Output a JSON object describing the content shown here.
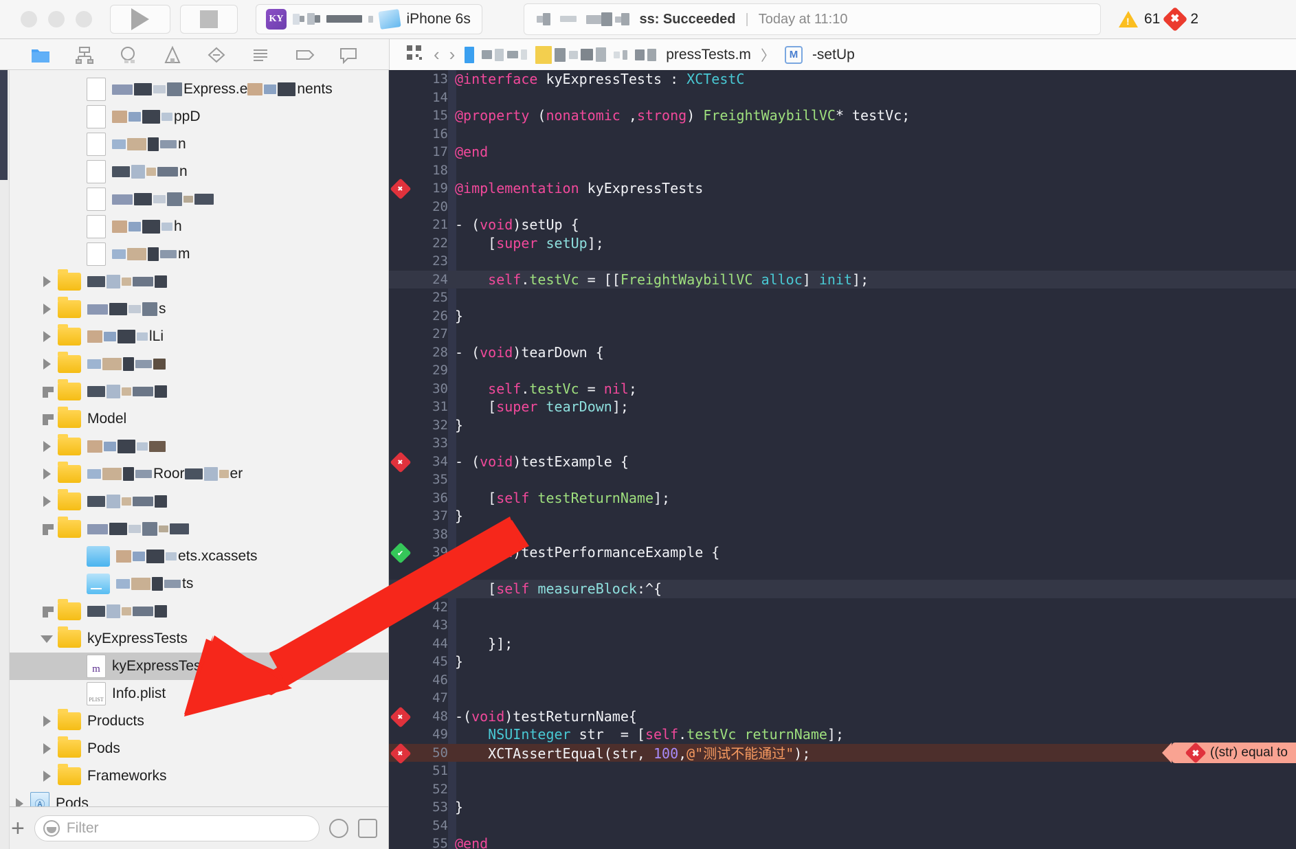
{
  "toolbar": {
    "scheme_name": "iPhone 6s",
    "app_icon_text": "KY",
    "status_text": "ss: Succeeded",
    "status_divider": "|",
    "status_time": "Today at 11:10",
    "warning_count": "61",
    "error_count": "2",
    "error_badge_glyph": "✖",
    "warning_glyph": "!",
    "play_label": "run-button",
    "stop_label": "stop-button"
  },
  "navigator_toolbar": {
    "icons": [
      {
        "name": "project-navigator-icon",
        "active": true
      },
      {
        "name": "source-control-navigator-icon",
        "active": false
      },
      {
        "name": "symbol-navigator-icon",
        "active": false
      },
      {
        "name": "find-navigator-icon",
        "active": false
      },
      {
        "name": "issue-navigator-icon",
        "active": false
      },
      {
        "name": "test-navigator-icon",
        "active": false
      },
      {
        "name": "debug-navigator-icon",
        "active": false
      },
      {
        "name": "breakpoint-navigator-icon",
        "active": false
      },
      {
        "name": "report-navigator-icon",
        "active": false
      }
    ]
  },
  "jumpbar": {
    "related_items_icon": "grid-icon",
    "back_arrow": "‹",
    "forward_arrow": "›",
    "crumb_blurred": "",
    "crumb_file": "pressTests.m",
    "separator": "〉",
    "method_badge": "M",
    "crumb_method": "-setUp"
  },
  "navigator": {
    "rows": [
      {
        "label": "Express.e",
        "suffix": "nents",
        "kind": "file-blurred",
        "indent": 2,
        "twisty": "none",
        "blurred": true
      },
      {
        "label": "ppD",
        "kind": "file-blurred",
        "indent": 2,
        "twisty": "none",
        "blurred": true
      },
      {
        "label": "n",
        "kind": "file-blurred",
        "indent": 2,
        "twisty": "none",
        "blurred": true
      },
      {
        "label": "n",
        "kind": "file-blurred",
        "indent": 2,
        "twisty": "none",
        "blurred": true
      },
      {
        "label": "",
        "kind": "file-blurred",
        "indent": 2,
        "twisty": "none",
        "blurred": true
      },
      {
        "label": "h",
        "kind": "file-blurred",
        "indent": 2,
        "twisty": "none",
        "blurred": true
      },
      {
        "label": "m",
        "kind": "file-blurred",
        "indent": 2,
        "twisty": "none",
        "blurred": true
      },
      {
        "label": "",
        "kind": "folder",
        "indent": 1,
        "twisty": "closed",
        "blurred": true
      },
      {
        "label": "s",
        "kind": "folder",
        "indent": 1,
        "twisty": "closed",
        "blurred": true
      },
      {
        "label": "lLi",
        "kind": "folder",
        "indent": 1,
        "twisty": "closed",
        "blurred": true
      },
      {
        "label": "",
        "kind": "folder",
        "indent": 1,
        "twisty": "closed",
        "blurred": true
      },
      {
        "label": "",
        "kind": "folder",
        "indent": 1,
        "twisty": "half",
        "blurred": true
      },
      {
        "label": "Model",
        "kind": "folder",
        "indent": 1,
        "twisty": "half",
        "blurred": false
      },
      {
        "label": "",
        "kind": "folder",
        "indent": 1,
        "twisty": "closed",
        "blurred": true
      },
      {
        "label": "Roor",
        "suffix": "er",
        "kind": "folder",
        "indent": 1,
        "twisty": "closed",
        "blurred": true
      },
      {
        "label": "",
        "kind": "folder",
        "indent": 1,
        "twisty": "closed",
        "blurred": true
      },
      {
        "label": "",
        "kind": "folder",
        "indent": 1,
        "twisty": "half",
        "blurred": true
      },
      {
        "label": "ets.xcassets",
        "kind": "xcassets",
        "indent": 2,
        "twisty": "none",
        "blurred": true
      },
      {
        "label": "ts",
        "kind": "storyboard",
        "indent": 2,
        "twisty": "none",
        "blurred": true
      },
      {
        "label": "",
        "kind": "folder",
        "indent": 1,
        "twisty": "half",
        "blurred": true
      },
      {
        "label": "kyExpressTests",
        "kind": "folder",
        "indent": 1,
        "twisty": "open",
        "blurred": false
      },
      {
        "label": "kyExpressTests.m",
        "kind": "m-file",
        "indent": 2,
        "twisty": "none",
        "blurred": false,
        "selected": true
      },
      {
        "label": "Info.plist",
        "kind": "plist",
        "indent": 2,
        "twisty": "none",
        "blurred": false
      },
      {
        "label": "Products",
        "kind": "folder",
        "indent": 1,
        "twisty": "closed",
        "blurred": false
      },
      {
        "label": "Pods",
        "kind": "folder",
        "indent": 1,
        "twisty": "closed",
        "blurred": false
      },
      {
        "label": "Frameworks",
        "kind": "folder",
        "indent": 1,
        "twisty": "closed",
        "blurred": false
      },
      {
        "label": "Pods",
        "kind": "project",
        "indent": 0,
        "twisty": "closed",
        "blurred": false
      }
    ],
    "footer": {
      "add_label": "+",
      "filter_placeholder": "Filter",
      "recent_icon": "clock-icon",
      "sourcecontrol_icon": "modified-files-icon"
    }
  },
  "editor": {
    "error_balloon": "((str) equal to",
    "error_balloon_glyph": "✖",
    "lines": [
      {
        "n": "13",
        "mark": "",
        "state": "",
        "tokens": [
          {
            "t": "@interface",
            "c": "k"
          },
          {
            "t": " ",
            "c": "w"
          },
          {
            "t": "kyExpressTests",
            "c": "w"
          },
          {
            "t": " : ",
            "c": "w"
          },
          {
            "t": "XCTestC",
            "c": "type"
          }
        ]
      },
      {
        "n": "14",
        "mark": "",
        "state": "",
        "tokens": []
      },
      {
        "n": "15",
        "mark": "",
        "state": "",
        "tokens": [
          {
            "t": "@property",
            "c": "k"
          },
          {
            "t": " (",
            "c": "w"
          },
          {
            "t": "nonatomic",
            "c": "k"
          },
          {
            "t": " ,",
            "c": "w"
          },
          {
            "t": "strong",
            "c": "k"
          },
          {
            "t": ") ",
            "c": "w"
          },
          {
            "t": "FreightWaybillVC",
            "c": "cls"
          },
          {
            "t": "* testVc;",
            "c": "w"
          }
        ]
      },
      {
        "n": "16",
        "mark": "",
        "state": "",
        "tokens": []
      },
      {
        "n": "17",
        "mark": "",
        "state": "",
        "tokens": [
          {
            "t": "@end",
            "c": "k"
          }
        ]
      },
      {
        "n": "18",
        "mark": "",
        "state": "",
        "tokens": []
      },
      {
        "n": "19",
        "mark": "err",
        "state": "",
        "tokens": [
          {
            "t": "@implementation",
            "c": "k"
          },
          {
            "t": " kyExpressTests",
            "c": "w"
          }
        ]
      },
      {
        "n": "20",
        "mark": "",
        "state": "",
        "tokens": []
      },
      {
        "n": "21",
        "mark": "",
        "state": "",
        "tokens": [
          {
            "t": "- (",
            "c": "w"
          },
          {
            "t": "void",
            "c": "k"
          },
          {
            "t": ")setUp {",
            "c": "w"
          }
        ]
      },
      {
        "n": "22",
        "mark": "",
        "state": "",
        "tokens": [
          {
            "t": "    [",
            "c": "w"
          },
          {
            "t": "super",
            "c": "k"
          },
          {
            "t": " ",
            "c": "w"
          },
          {
            "t": "setUp",
            "c": "sel2"
          },
          {
            "t": "];",
            "c": "w"
          }
        ]
      },
      {
        "n": "23",
        "mark": "",
        "state": "",
        "tokens": []
      },
      {
        "n": "24",
        "mark": "",
        "state": "hl",
        "tokens": [
          {
            "t": "    ",
            "c": "w"
          },
          {
            "t": "self",
            "c": "k"
          },
          {
            "t": ".",
            "c": "w"
          },
          {
            "t": "testVc",
            "c": "cls"
          },
          {
            "t": " = [[",
            "c": "w"
          },
          {
            "t": "FreightWaybillVC",
            "c": "cls"
          },
          {
            "t": " ",
            "c": "w"
          },
          {
            "t": "alloc",
            "c": "type"
          },
          {
            "t": "] ",
            "c": "w"
          },
          {
            "t": "init",
            "c": "type"
          },
          {
            "t": "];",
            "c": "w"
          }
        ]
      },
      {
        "n": "25",
        "mark": "",
        "state": "",
        "tokens": []
      },
      {
        "n": "26",
        "mark": "",
        "state": "",
        "tokens": [
          {
            "t": "}",
            "c": "w"
          }
        ]
      },
      {
        "n": "27",
        "mark": "",
        "state": "",
        "tokens": []
      },
      {
        "n": "28",
        "mark": "",
        "state": "",
        "tokens": [
          {
            "t": "- (",
            "c": "w"
          },
          {
            "t": "void",
            "c": "k"
          },
          {
            "t": ")tearDown {",
            "c": "w"
          }
        ]
      },
      {
        "n": "29",
        "mark": "",
        "state": "",
        "tokens": []
      },
      {
        "n": "30",
        "mark": "",
        "state": "",
        "tokens": [
          {
            "t": "    ",
            "c": "w"
          },
          {
            "t": "self",
            "c": "k"
          },
          {
            "t": ".",
            "c": "w"
          },
          {
            "t": "testVc",
            "c": "cls"
          },
          {
            "t": " = ",
            "c": "w"
          },
          {
            "t": "nil",
            "c": "k"
          },
          {
            "t": ";",
            "c": "w"
          }
        ]
      },
      {
        "n": "31",
        "mark": "",
        "state": "",
        "tokens": [
          {
            "t": "    [",
            "c": "w"
          },
          {
            "t": "super",
            "c": "k"
          },
          {
            "t": " ",
            "c": "w"
          },
          {
            "t": "tearDown",
            "c": "sel2"
          },
          {
            "t": "];",
            "c": "w"
          }
        ]
      },
      {
        "n": "32",
        "mark": "",
        "state": "",
        "tokens": [
          {
            "t": "}",
            "c": "w"
          }
        ]
      },
      {
        "n": "33",
        "mark": "",
        "state": "",
        "tokens": []
      },
      {
        "n": "34",
        "mark": "err",
        "state": "",
        "tokens": [
          {
            "t": "- (",
            "c": "w"
          },
          {
            "t": "void",
            "c": "k"
          },
          {
            "t": ")testExample {",
            "c": "w"
          }
        ]
      },
      {
        "n": "35",
        "mark": "",
        "state": "",
        "tokens": []
      },
      {
        "n": "36",
        "mark": "",
        "state": "",
        "tokens": [
          {
            "t": "    [",
            "c": "w"
          },
          {
            "t": "self",
            "c": "k"
          },
          {
            "t": " ",
            "c": "w"
          },
          {
            "t": "testReturnName",
            "c": "cls"
          },
          {
            "t": "];",
            "c": "w"
          }
        ]
      },
      {
        "n": "37",
        "mark": "",
        "state": "",
        "tokens": [
          {
            "t": "}",
            "c": "w"
          }
        ]
      },
      {
        "n": "38",
        "mark": "",
        "state": "",
        "tokens": []
      },
      {
        "n": "39",
        "mark": "ok",
        "state": "",
        "tokens": [
          {
            "t": "- (",
            "c": "w"
          },
          {
            "t": "void",
            "c": "k"
          },
          {
            "t": ")testPerformanceExample {",
            "c": "w"
          }
        ]
      },
      {
        "n": "40",
        "mark": "",
        "state": "",
        "tokens": []
      },
      {
        "n": "41",
        "mark": "diamond",
        "state": "hl",
        "tokens": [
          {
            "t": "    [",
            "c": "w"
          },
          {
            "t": "self",
            "c": "k"
          },
          {
            "t": " ",
            "c": "w"
          },
          {
            "t": "measureBlock",
            "c": "sel2"
          },
          {
            "t": ":^{",
            "c": "w"
          }
        ]
      },
      {
        "n": "42",
        "mark": "",
        "state": "",
        "tokens": []
      },
      {
        "n": "43",
        "mark": "",
        "state": "",
        "tokens": []
      },
      {
        "n": "44",
        "mark": "",
        "state": "",
        "tokens": [
          {
            "t": "    }];",
            "c": "w"
          }
        ]
      },
      {
        "n": "45",
        "mark": "",
        "state": "",
        "tokens": [
          {
            "t": "}",
            "c": "w"
          }
        ]
      },
      {
        "n": "46",
        "mark": "",
        "state": "",
        "tokens": []
      },
      {
        "n": "47",
        "mark": "",
        "state": "",
        "tokens": []
      },
      {
        "n": "48",
        "mark": "err",
        "state": "",
        "tokens": [
          {
            "t": "-(",
            "c": "w"
          },
          {
            "t": "void",
            "c": "k"
          },
          {
            "t": ")testReturnName{",
            "c": "w"
          }
        ]
      },
      {
        "n": "49",
        "mark": "",
        "state": "",
        "tokens": [
          {
            "t": "    ",
            "c": "w"
          },
          {
            "t": "NSUInteger",
            "c": "type"
          },
          {
            "t": " str  = [",
            "c": "w"
          },
          {
            "t": "self",
            "c": "k"
          },
          {
            "t": ".",
            "c": "w"
          },
          {
            "t": "testVc",
            "c": "cls"
          },
          {
            "t": " ",
            "c": "w"
          },
          {
            "t": "returnName",
            "c": "cls"
          },
          {
            "t": "];",
            "c": "w"
          }
        ]
      },
      {
        "n": "50",
        "mark": "err",
        "state": "errline",
        "tokens": [
          {
            "t": "    XCTAssertEqual(str, ",
            "c": "w"
          },
          {
            "t": "100",
            "c": "num"
          },
          {
            "t": ",",
            "c": "w"
          },
          {
            "t": "@\"测试不能通过\"",
            "c": "str"
          },
          {
            "t": ");",
            "c": "w"
          }
        ]
      },
      {
        "n": "51",
        "mark": "",
        "state": "",
        "tokens": []
      },
      {
        "n": "52",
        "mark": "",
        "state": "",
        "tokens": []
      },
      {
        "n": "53",
        "mark": "",
        "state": "",
        "tokens": [
          {
            "t": "}",
            "c": "w"
          }
        ]
      },
      {
        "n": "54",
        "mark": "",
        "state": "",
        "tokens": []
      },
      {
        "n": "55",
        "mark": "",
        "state": "",
        "tokens": [
          {
            "t": "@end",
            "c": "k"
          }
        ]
      }
    ]
  },
  "annotation": {
    "arrow_color": "#f6271b",
    "arrow_name": "red-pointer-arrow"
  }
}
